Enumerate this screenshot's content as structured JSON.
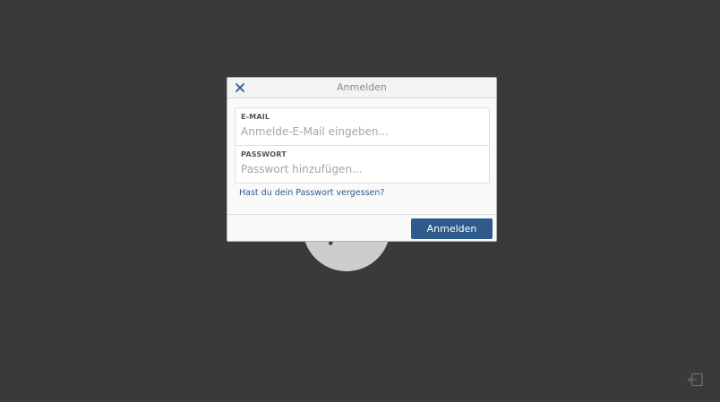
{
  "background": {
    "color": "#3a3a3a"
  },
  "dialog": {
    "title": "Anmelden",
    "close_icon": "close-icon",
    "email": {
      "label": "E-MAIL",
      "value": "",
      "placeholder": "Anmelde-E-Mail eingeben..."
    },
    "password": {
      "label": "PASSWORT",
      "value": "",
      "placeholder": "Passwort hinzufügen..."
    },
    "forgot_link": "Hast du dein Passwort vergessen?",
    "submit_label": "Anmelden",
    "accent_color": "#2e5a8c"
  },
  "corner": {
    "exit_icon": "exit-icon"
  }
}
